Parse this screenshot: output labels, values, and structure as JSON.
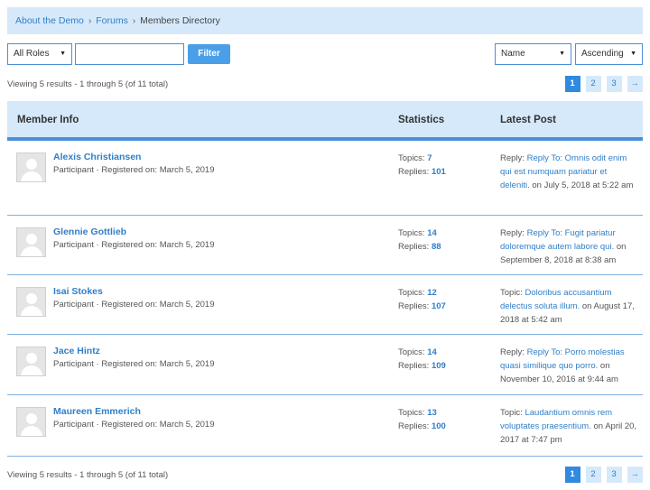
{
  "breadcrumb": {
    "root": "About the Demo",
    "forums": "Forums",
    "current": "Members Directory",
    "separator": "›"
  },
  "filters": {
    "role_select": "All Roles",
    "search_value": "",
    "filter_button": "Filter",
    "sort_select": "Name",
    "order_select": "Ascending"
  },
  "results_text": "Viewing 5 results - 1 through 5 (of 11 total)",
  "pagination": {
    "pages": [
      "1",
      "2",
      "3"
    ],
    "next": "→",
    "current": "1"
  },
  "table": {
    "col_member": "Member Info",
    "col_stats": "Statistics",
    "col_latest": "Latest Post",
    "topics_label": "Topics:",
    "replies_label": "Replies:",
    "rows": [
      {
        "name": "Alexis Christiansen",
        "meta": "Participant · Registered on: March 5, 2019",
        "topics": "7",
        "replies": "101",
        "post_type": "Reply:",
        "post_link": "Reply To: Omnis odit enim qui est numquam pariatur et deleniti.",
        "post_date": "on July 5, 2018 at 5:22 am"
      },
      {
        "name": "Glennie Gottlieb",
        "meta": "Participant · Registered on: March 5, 2019",
        "topics": "14",
        "replies": "88",
        "post_type": "Reply:",
        "post_link": "Reply To: Fugit pariatur doloremque autem labore qui.",
        "post_date": "on September 8, 2018 at 8:38 am"
      },
      {
        "name": "Isai Stokes",
        "meta": "Participant · Registered on: March 5, 2019",
        "topics": "12",
        "replies": "107",
        "post_type": "Topic:",
        "post_link": "Doloribus accusantium delectus soluta illum.",
        "post_date": "on August 17, 2018 at 5:42 am"
      },
      {
        "name": "Jace Hintz",
        "meta": "Participant · Registered on: March 5, 2019",
        "topics": "14",
        "replies": "109",
        "post_type": "Reply:",
        "post_link": "Reply To: Porro molestias quasi similique quo porro.",
        "post_date": "on November 10, 2016 at 9:44 am"
      },
      {
        "name": "Maureen Emmerich",
        "meta": "Participant · Registered on: March 5, 2019",
        "topics": "13",
        "replies": "100",
        "post_type": "Topic:",
        "post_link": "Laudantium omnis rem voluptates praesentium.",
        "post_date": "on April 20, 2017 at 7:47 pm"
      }
    ]
  },
  "icons": {
    "avatar": "default-avatar-icon",
    "caret": "chevron-down-icon"
  },
  "colors": {
    "accent": "#2f8ae0",
    "link": "#2f7fc8",
    "header_bg": "#d6e9fb",
    "border": "#4a90d9"
  }
}
